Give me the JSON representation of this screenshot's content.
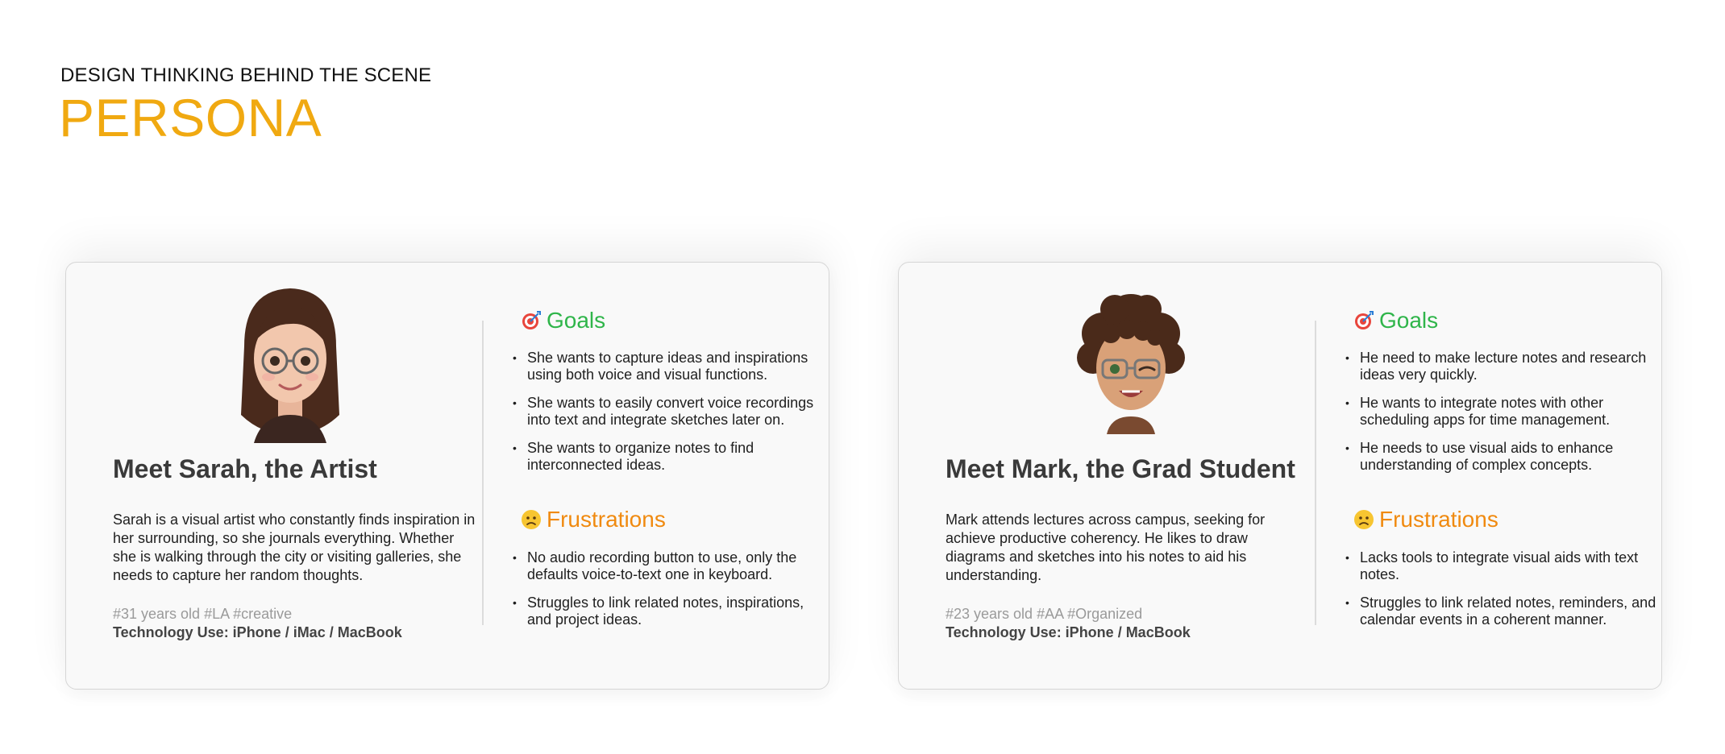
{
  "header": {
    "eyebrow": "DESIGN THINKING BEHIND THE SCENE",
    "title": "PERSONA"
  },
  "colors": {
    "title": "#f0a911",
    "goals": "#2fb54a",
    "frustrations": "#f08a10"
  },
  "personas": [
    {
      "avatar_icon": "memoji-woman-avatar-icon",
      "title": "Meet Sarah, the Artist",
      "bio": "Sarah is a visual artist who constantly finds inspiration in her surrounding,  so she journals everything. Whether she is walking through the city or visiting galleries, she needs to capture her random thoughts.",
      "tags": "#31 years old #LA #creative",
      "tech": "Technology Use: iPhone / iMac / MacBook",
      "goals_label": "Goals",
      "goals": [
        "She wants to capture ideas and inspirations using both voice and visual functions.",
        "She wants to easily convert voice recordings into text and integrate sketches later on.",
        "She wants to organize notes to find interconnected ideas."
      ],
      "frustrations_label": "Frustrations",
      "frustrations": [
        "No audio recording button to use, only the defaults voice-to-text one in keyboard.",
        "Struggles to link related notes, inspirations, and project ideas."
      ]
    },
    {
      "avatar_icon": "memoji-man-avatar-icon",
      "title": "Meet Mark, the Grad Student",
      "bio": "Mark attends lectures across campus, seeking for achieve productive coherency. He likes to draw diagrams and sketches into his notes to aid his understanding.",
      "tags": "#23 years old #AA #Organized",
      "tech": "Technology Use: iPhone / MacBook",
      "goals_label": "Goals",
      "goals": [
        "He need to make lecture notes and research ideas very quickly.",
        "He wants to integrate notes with other scheduling apps for time management.",
        "He needs to use visual aids to enhance understanding of complex concepts."
      ],
      "frustrations_label": "Frustrations",
      "frustrations": [
        "Lacks tools to integrate visual aids with text notes.",
        "Struggles to link related notes, reminders, and calendar events in a coherent manner."
      ]
    }
  ]
}
